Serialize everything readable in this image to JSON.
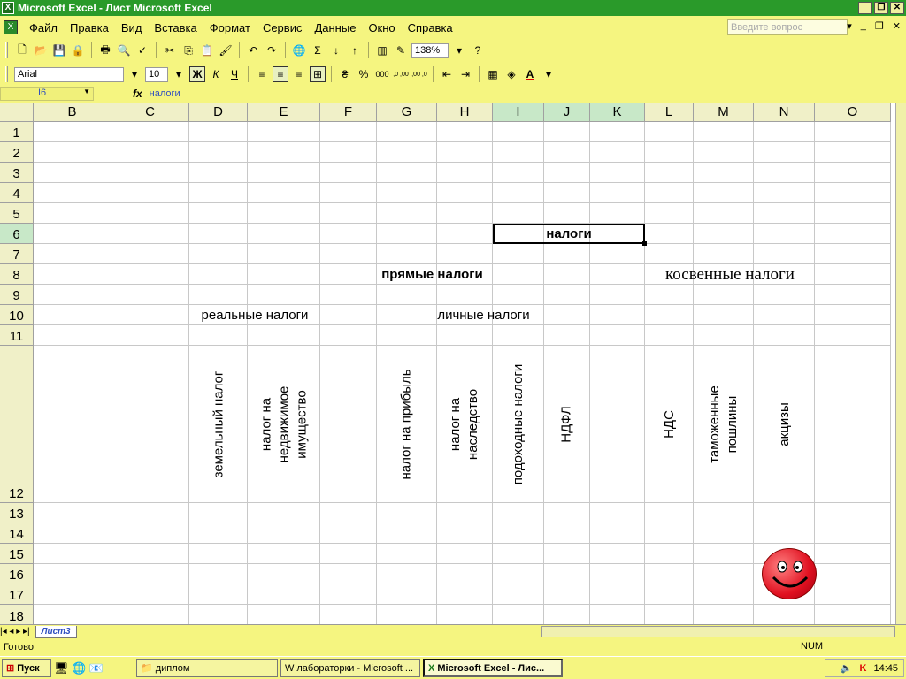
{
  "window": {
    "title": "Microsoft Excel - Лист Microsoft Excel",
    "icon": "excel-icon"
  },
  "menu": {
    "items": [
      "Файл",
      "Правка",
      "Вид",
      "Вставка",
      "Формат",
      "Сервис",
      "Данные",
      "Окно",
      "Справка"
    ],
    "ask_placeholder": "Введите вопрос"
  },
  "toolbar": {
    "zoom": "138%",
    "font": "Arial",
    "size": "10",
    "bold": "Ж",
    "italic": "К",
    "underline": "Ч",
    "percent": "%",
    "thousands": "000",
    "inc_decimal": ",0 ,00",
    "dec_decimal": ",00 ,0"
  },
  "formula_bar": {
    "cell_ref": "I6",
    "fx": "fx",
    "content": "налоги"
  },
  "columns": [
    "B",
    "C",
    "D",
    "E",
    "F",
    "G",
    "H",
    "I",
    "J",
    "K",
    "L",
    "M",
    "N",
    "O"
  ],
  "rows": [
    "1",
    "2",
    "3",
    "4",
    "5",
    "6",
    "7",
    "8",
    "9",
    "10",
    "11",
    "12",
    "13",
    "14",
    "15",
    "16",
    "17",
    "18"
  ],
  "cells": {
    "I6": "налоги",
    "G8": "прямые налоги",
    "L8": "косвенные налоги",
    "D10": "реальные налоги",
    "H10": "личные налоги",
    "D12": "земельный налог",
    "E12": "налог на недвижимое имущество",
    "G12": "налог на прибыль",
    "H12": "налог на наследство",
    "I12": "подоходные налоги",
    "J12": "НДФЛ",
    "L12": "НДС",
    "M12": "таможенные пошлины",
    "N12": "акцизы"
  },
  "sheet_tab": "Лист3",
  "status": {
    "left": "Готово",
    "num": "NUM"
  },
  "taskbar": {
    "start": "Пуск",
    "items": [
      "диплом",
      "лабораторки - Microsoft ...",
      "Microsoft Excel - Лис..."
    ],
    "time": "14:45"
  }
}
